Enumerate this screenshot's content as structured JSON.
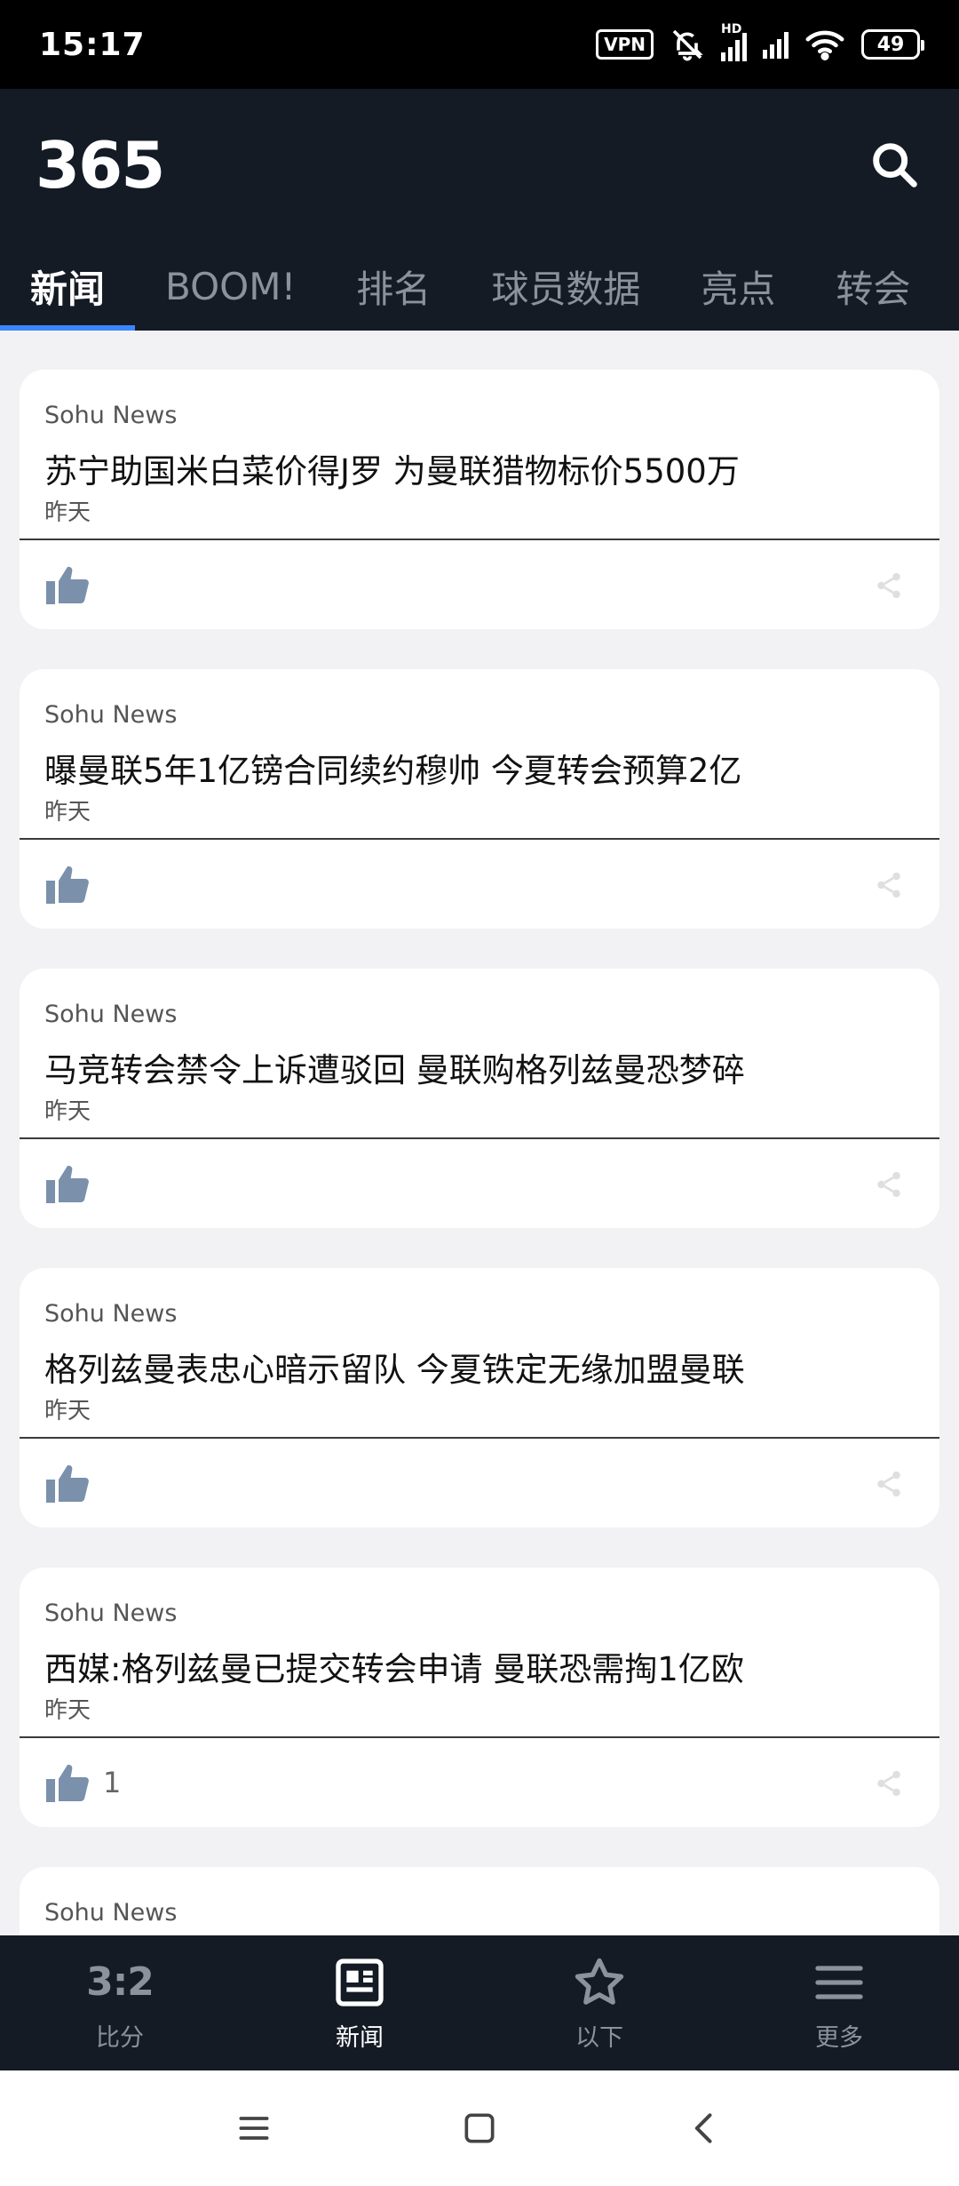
{
  "status_bar": {
    "time": "15:17",
    "vpn": "VPN",
    "hd": "HD",
    "battery": "49"
  },
  "app": {
    "logo": "365"
  },
  "tabs": [
    {
      "label": "新闻",
      "active": true
    },
    {
      "label": "BOOM!",
      "active": false
    },
    {
      "label": "排名",
      "active": false
    },
    {
      "label": "球员数据",
      "active": false
    },
    {
      "label": "亮点",
      "active": false
    },
    {
      "label": "转会",
      "active": false
    }
  ],
  "news": [
    {
      "source": "Sohu News",
      "headline": "苏宁助国米白菜价得J罗 为曼联猎物标价5500万",
      "date": "昨天",
      "likes": ""
    },
    {
      "source": "Sohu News",
      "headline": "曝曼联5年1亿镑合同续约穆帅 今夏转会预算2亿",
      "date": "昨天",
      "likes": ""
    },
    {
      "source": "Sohu News",
      "headline": "马竞转会禁令上诉遭驳回 曼联购格列兹曼恐梦碎",
      "date": "昨天",
      "likes": ""
    },
    {
      "source": "Sohu News",
      "headline": "格列兹曼表忠心暗示留队 今夏铁定无缘加盟曼联",
      "date": "昨天",
      "likes": ""
    },
    {
      "source": "Sohu News",
      "headline": "西媒:格列兹曼已提交转会申请 曼联恐需掏1亿欧",
      "date": "昨天",
      "likes": "1"
    },
    {
      "source": "Sohu News"
    }
  ],
  "bottom_nav": [
    {
      "label": "比分",
      "icon": "scores-icon",
      "glyph": "3:2",
      "active": false
    },
    {
      "label": "新闻",
      "icon": "news-icon",
      "active": true
    },
    {
      "label": "以下",
      "icon": "star-icon",
      "active": false
    },
    {
      "label": "更多",
      "icon": "menu-icon",
      "active": false
    }
  ],
  "colors": {
    "bar_bg": "#141b25",
    "accent": "#3a86ff",
    "like": "#7a90ab"
  }
}
